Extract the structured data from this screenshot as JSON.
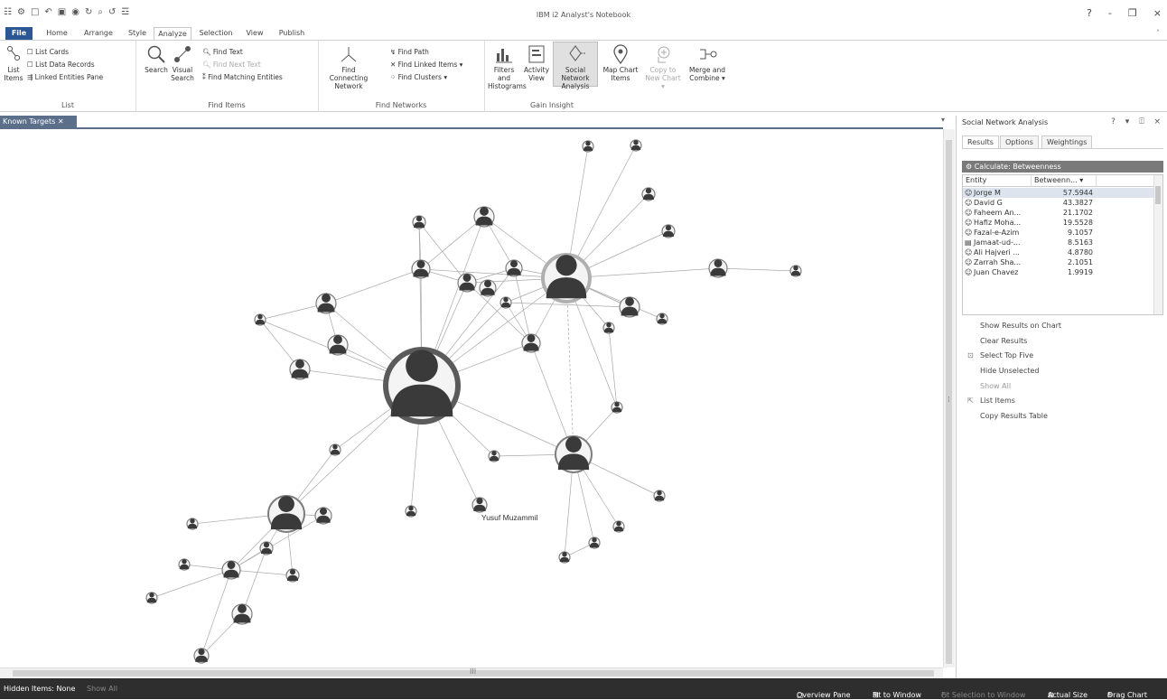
{
  "window": {
    "title": "IBM i2 Analyst's Notebook",
    "buttons": [
      "?",
      "-",
      "❐",
      "×"
    ]
  },
  "quick_access": [
    "☷",
    "⚙",
    "□",
    "↶",
    "▣",
    "◉",
    "↻",
    "⌕",
    "↺",
    "☲"
  ],
  "ribbon_tabs": [
    "File",
    "Home",
    "Arrange",
    "Style",
    "Analyze",
    "Selection",
    "View",
    "Publish"
  ],
  "active_tab": "Analyze",
  "ribbon": {
    "list": {
      "label": "List",
      "list_items": "List Items",
      "list_cards": "List Cards",
      "list_data_records": "List Data Records",
      "linked_entities_pane": "Linked Entities Pane"
    },
    "find_items": {
      "label": "Find Items",
      "search": "Search",
      "visual_search": "Visual Search",
      "find_text": "Find Text",
      "find_next_text": "Find Next Text",
      "find_matching_entities": "Find Matching Entities"
    },
    "find_networks": {
      "label": "Find Networks",
      "find_connecting_network": "Find Connecting Network",
      "find_path": "Find Path",
      "find_linked_items": "Find Linked Items ▾",
      "find_clusters": "Find Clusters ▾"
    },
    "gain_insight": {
      "label": "Gain Insight",
      "filters_histograms": "Filters and Histograms",
      "activity_view": "Activity View",
      "social_network_analysis": "Social Network Analysis",
      "map_chart_items": "Map Chart Items",
      "copy_to_new_chart": "Copy to New Chart ▾",
      "merge_and_combine": "Merge and Combine ▾"
    },
    "collapse": "˄"
  },
  "document_tab": "Known Targets  ✕",
  "graph": {
    "labeled_nodes": [
      "Yusuf Muzammil"
    ],
    "colors": {
      "edge": "#a9a9a9",
      "node_ring": "#7d7d7d",
      "central_ring": "#5b5b5b",
      "person": "#3a3a3a"
    }
  },
  "pane": {
    "title": "Social Network Analysis",
    "header_buttons": "? ▾ ⍐ ×",
    "tabs": [
      "Results",
      "Options",
      "Weightings"
    ],
    "calculate": "Calculate: Betweenness",
    "columns": [
      "Entity",
      "Betweenn... ▾"
    ],
    "rows": [
      {
        "entity": "Jorge M",
        "value": "57.5944"
      },
      {
        "entity": "David G",
        "value": "43.3827"
      },
      {
        "entity": "Faheem An...",
        "value": "21.1702"
      },
      {
        "entity": "Hafiz Moha...",
        "value": "19.5528"
      },
      {
        "entity": "Fazal-e-Azim",
        "value": "9.1057"
      },
      {
        "entity": "Jamaat-ud-...",
        "value": "8.5163"
      },
      {
        "entity": "Ali Hajveri ...",
        "value": "4.8780"
      },
      {
        "entity": "Zarrah Sha...",
        "value": "2.1051"
      },
      {
        "entity": "Juan Chavez",
        "value": "1.9919"
      }
    ],
    "actions": [
      "Show Results on Chart",
      "Clear Results",
      "Select Top Five",
      "Hide Unselected",
      "Show All",
      "List Items",
      "Copy Results Table"
    ]
  },
  "status": {
    "hidden_items": "Hidden Items: None",
    "show_all": "Show All",
    "overview_pane": "Overview Pane",
    "fit_to_window": "Fit to Window",
    "fit_selection": "Fit Selection to Window",
    "actual_size": "Actual Size",
    "drag_chart": "Drag Chart"
  },
  "scroll_mid": "III"
}
